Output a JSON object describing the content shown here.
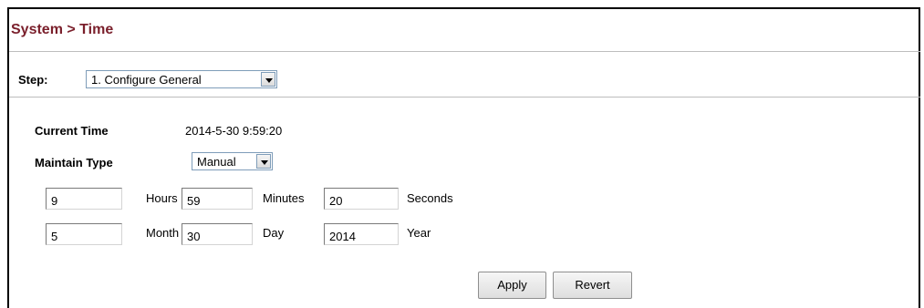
{
  "header": {
    "title": "System > Time"
  },
  "step": {
    "label": "Step:",
    "selected": "1. Configure General"
  },
  "current_time": {
    "label": "Current Time",
    "value": "2014-5-30 9:59:20"
  },
  "maintain_type": {
    "label": "Maintain Type",
    "selected": "Manual"
  },
  "time_fields": {
    "hours": {
      "value": "9",
      "label": "Hours"
    },
    "minutes": {
      "value": "59",
      "label": "Minutes"
    },
    "seconds": {
      "value": "20",
      "label": "Seconds"
    }
  },
  "date_fields": {
    "month": {
      "value": "5",
      "label": "Month"
    },
    "day": {
      "value": "30",
      "label": "Day"
    },
    "year": {
      "value": "2014",
      "label": "Year"
    }
  },
  "buttons": {
    "apply": "Apply",
    "revert": "Revert"
  }
}
